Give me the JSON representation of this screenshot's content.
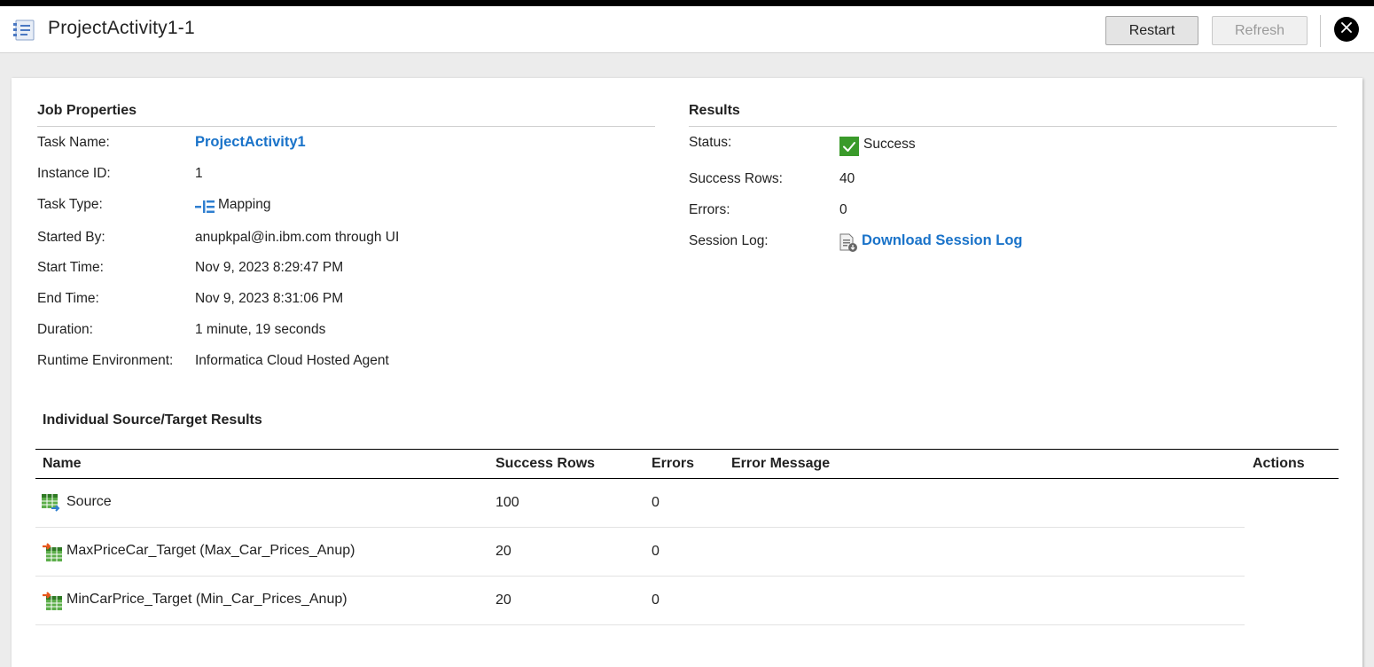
{
  "header": {
    "title": "ProjectActivity1-1",
    "restart_label": "Restart",
    "refresh_label": "Refresh",
    "app_icon": "list-document-icon",
    "close_icon": "close-icon"
  },
  "job_properties": {
    "title": "Job Properties",
    "rows": [
      {
        "label": "Task Name:",
        "value": "ProjectActivity1"
      },
      {
        "label": "Instance ID:",
        "value": "1"
      },
      {
        "label": "Task Type:",
        "value": "Mapping"
      },
      {
        "label": "Started By:",
        "value": "anupkpal@in.ibm.com through UI"
      },
      {
        "label": "Start Time:",
        "value": "Nov 9, 2023 8:29:47 PM"
      },
      {
        "label": "End Time:",
        "value": "Nov 9, 2023 8:31:06 PM"
      },
      {
        "label": "Duration:",
        "value": "1 minute, 19 seconds"
      },
      {
        "label": "Runtime Environment:",
        "value": "Informatica Cloud Hosted Agent"
      }
    ]
  },
  "results": {
    "title": "Results",
    "rows": [
      {
        "label": "Status:",
        "value": "Success"
      },
      {
        "label": "Success Rows:",
        "value": "40"
      },
      {
        "label": "Errors:",
        "value": "0"
      },
      {
        "label": "Session Log:",
        "value": "Download Session Log"
      }
    ]
  },
  "individual": {
    "title": "Individual Source/Target Results",
    "columns": [
      "Name",
      "Success Rows",
      "Errors",
      "Error Message",
      "Actions"
    ],
    "rows": [
      {
        "name": "Source",
        "success_rows": "100",
        "errors": "0",
        "error_message": "",
        "icon": "source-table-icon"
      },
      {
        "name": "MaxPriceCar_Target (Max_Car_Prices_Anup)",
        "success_rows": "20",
        "errors": "0",
        "error_message": "",
        "icon": "target-table-icon"
      },
      {
        "name": "MinCarPrice_Target (Min_Car_Prices_Anup)",
        "success_rows": "20",
        "errors": "0",
        "error_message": "",
        "icon": "target-table-icon"
      }
    ]
  },
  "colors": {
    "link": "#1a73c9",
    "success_green": "#3a9a2a",
    "mapping_blue": "#2f7fd0"
  }
}
